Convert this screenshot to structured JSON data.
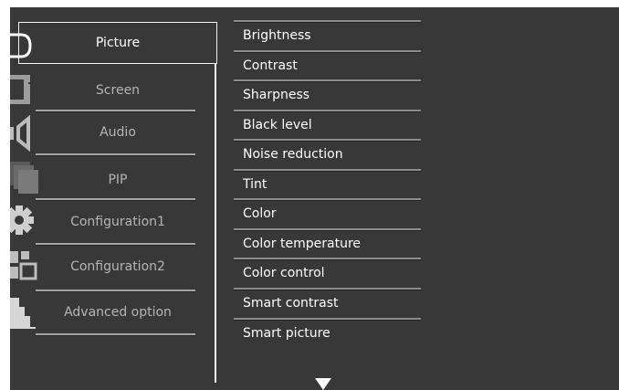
{
  "menu": {
    "items": [
      {
        "label": "Picture",
        "icon": "picture-icon",
        "selected": true
      },
      {
        "label": "Screen",
        "icon": "screen-icon",
        "selected": false
      },
      {
        "label": "Audio",
        "icon": "audio-icon",
        "selected": false
      },
      {
        "label": "PIP",
        "icon": "pip-icon",
        "selected": false
      },
      {
        "label": "Configuration1",
        "icon": "configuration1-icon",
        "selected": false
      },
      {
        "label": "Configuration2",
        "icon": "configuration2-icon",
        "selected": false
      },
      {
        "label": "Advanced option",
        "icon": "advanced-option-icon",
        "selected": false
      }
    ]
  },
  "submenu": {
    "items": [
      "Brightness",
      "Contrast",
      "Sharpness",
      "Black level",
      "Noise reduction",
      "Tint",
      "Color",
      "Color temperature",
      "Color control",
      "Smart contrast",
      "Smart picture"
    ],
    "more_indicator": "down-arrow-icon"
  },
  "colors": {
    "background": "#383838",
    "text_selected": "#ffffff",
    "text_normal": "#b5b5b5",
    "border": "#f2f2f2"
  }
}
